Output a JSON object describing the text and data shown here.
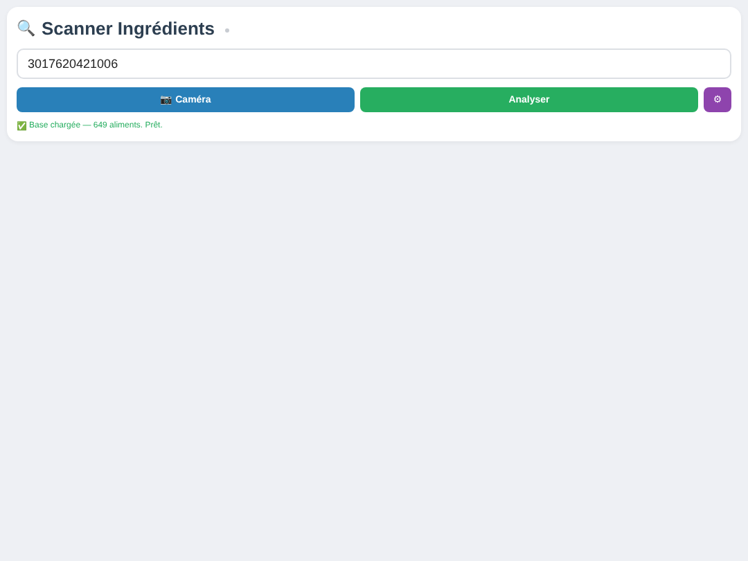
{
  "header": {
    "icon": "🔍",
    "title": "Scanner Ingrédients"
  },
  "barcode_field": {
    "value": "3017620421006"
  },
  "buttons": [
    {
      "kind": "camera",
      "label": "📷 Caméra"
    },
    {
      "kind": "analyze",
      "label": "Analyser"
    },
    {
      "kind": "settings",
      "label": "⚙"
    }
  ],
  "status": {
    "icon": "✅",
    "text": "Base chargée — 649 aliments. Prêt."
  }
}
